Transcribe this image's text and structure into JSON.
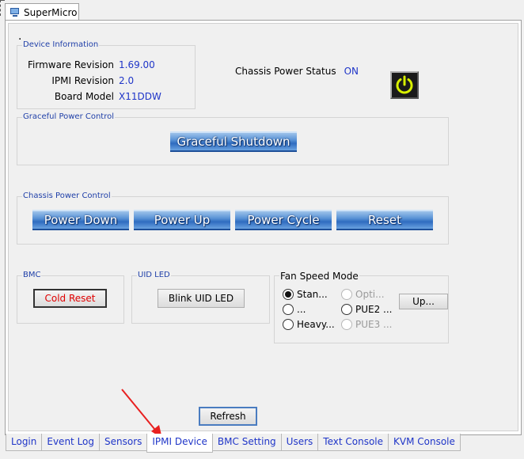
{
  "window": {
    "tab_label": "SuperMicro",
    "tab_icon": "computer-monitor-icon"
  },
  "device_info": {
    "title": "Device Information",
    "rows": [
      {
        "label": "Firmware Revision",
        "value": "1.69.00"
      },
      {
        "label": "IPMI Revision",
        "value": "2.0"
      },
      {
        "label": "Board Model",
        "value": "X11DDW"
      }
    ]
  },
  "chassis_status": {
    "label": "Chassis Power Status",
    "value": "ON",
    "icon": "power-icon",
    "icon_color": "#d8f000"
  },
  "graceful": {
    "title": "Graceful Power Control",
    "button": "Graceful Shutdown"
  },
  "chassis_control": {
    "title": "Chassis Power Control",
    "buttons": [
      "Power Down",
      "Power Up",
      "Power Cycle",
      "Reset"
    ]
  },
  "bmc": {
    "title": "BMC",
    "button": "Cold Reset",
    "button_color": "#e00000"
  },
  "uid_led": {
    "title": "UID LED",
    "button": "Blink UID LED"
  },
  "fan": {
    "title": "Fan Speed Mode",
    "options": [
      {
        "label": "Stan...",
        "selected": true,
        "enabled": true
      },
      {
        "label": "Opti...",
        "selected": false,
        "enabled": false
      },
      {
        "label": "...",
        "selected": false,
        "enabled": true
      },
      {
        "label": "PUE2 ...",
        "selected": false,
        "enabled": true
      },
      {
        "label": "Heavy...",
        "selected": false,
        "enabled": true
      },
      {
        "label": "PUE3 ...",
        "selected": false,
        "enabled": false
      }
    ],
    "update_button": "Up..."
  },
  "refresh_button": "Refresh",
  "bottom_tabs": [
    {
      "label": "Login",
      "active": false
    },
    {
      "label": "Event Log",
      "active": false
    },
    {
      "label": "Sensors",
      "active": false
    },
    {
      "label": "IPMI Device",
      "active": true
    },
    {
      "label": "BMC Setting",
      "active": false
    },
    {
      "label": "Users",
      "active": false
    },
    {
      "label": "Text Console",
      "active": false
    },
    {
      "label": "KVM Console",
      "active": false
    }
  ],
  "annotation": {
    "arrow_color": "#e82020"
  }
}
